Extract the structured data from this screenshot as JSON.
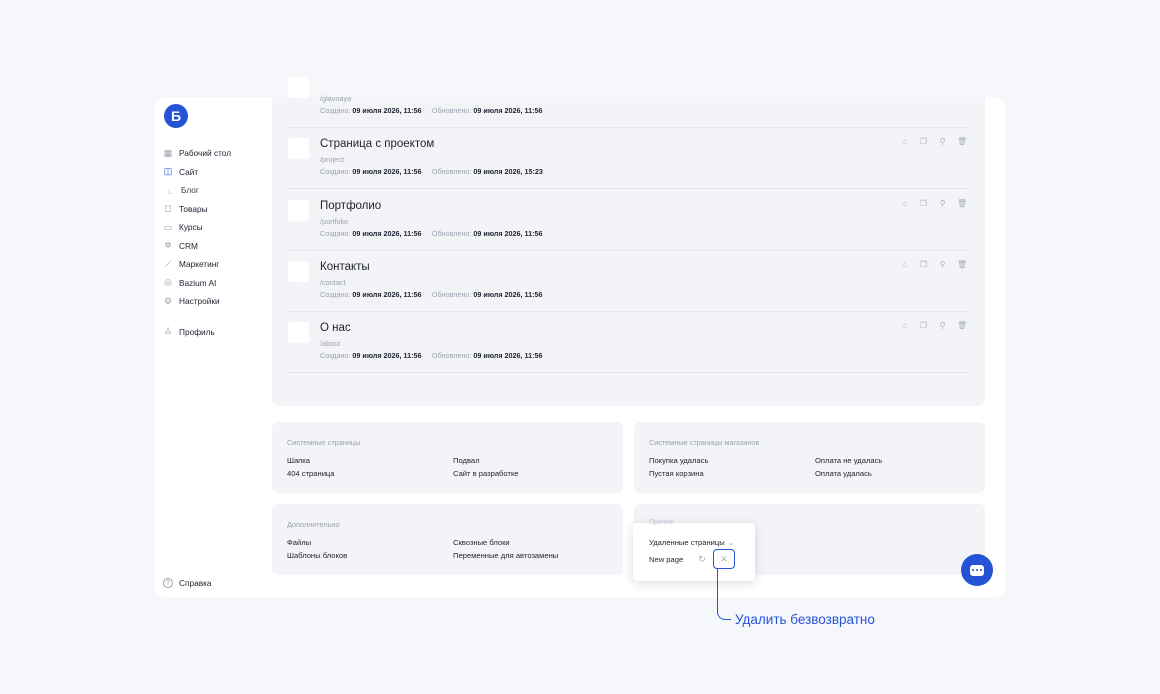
{
  "sidebar": {
    "logo": "Б",
    "items": [
      {
        "label": "Рабочий стол",
        "icon": "grid-icon",
        "glyph": "▦"
      },
      {
        "label": "Сайт",
        "icon": "layout-icon",
        "glyph": "◫"
      },
      {
        "label": "Блог",
        "icon": "subitem-icon",
        "glyph": "⌞"
      },
      {
        "label": "Товары",
        "icon": "bag-icon",
        "glyph": "◻"
      },
      {
        "label": "Курсы",
        "icon": "book-icon",
        "glyph": "▭"
      },
      {
        "label": "CRM",
        "icon": "network-icon",
        "glyph": "✲"
      },
      {
        "label": "Маркетинг",
        "icon": "chart-icon",
        "glyph": "⟋"
      },
      {
        "label": "Bazium AI",
        "icon": "ai-icon",
        "glyph": "◎"
      },
      {
        "label": "Настройки",
        "icon": "gear-icon",
        "glyph": "⚙"
      }
    ],
    "profile": "Профиль",
    "help": "Справка"
  },
  "pages": [
    {
      "title": "",
      "slug": "/glavnaya",
      "created": "09 июля 2026, 11:56",
      "updated": "09 июля 2026, 11:56"
    },
    {
      "title": "Страница с проектом",
      "slug": "/project",
      "created": "09 июля 2026, 11:56",
      "updated": "09 июля 2026, 15:23"
    },
    {
      "title": "Портфолио",
      "slug": "/portfolio",
      "created": "09 июля 2026, 11:56",
      "updated": "09 июля 2026, 11:56"
    },
    {
      "title": "Контакты",
      "slug": "/contact",
      "created": "09 июля 2026, 11:56",
      "updated": "09 июля 2026, 11:56"
    },
    {
      "title": "О нас",
      "slug": "/about",
      "created": "09 июля 2026, 11:56",
      "updated": "09 июля 2026, 11:56"
    }
  ],
  "meta_labels": {
    "created": "Создано:",
    "updated": "Обновлено:",
    "sep": "·"
  },
  "row_actions": [
    "⌂",
    "❐",
    "⚲",
    "🗑"
  ],
  "cards": {
    "system": {
      "title": "Системные страницы",
      "links": [
        "Шапка",
        "Подвал",
        "404 страница",
        "Сайт в разработке"
      ]
    },
    "shop": {
      "title": "Системные страницы магазинов",
      "links": [
        "Покупка удалась",
        "Оплата не удалась",
        "Пустая корзина",
        "Оплата удалась"
      ]
    },
    "extra": {
      "title": "Дополнительно",
      "links": [
        "Файлы",
        "Сквозные блоки",
        "Шаблоны блоков",
        "Переменные для автозамены"
      ]
    }
  },
  "popup": {
    "ghost": "Прочее",
    "heading": "Удаленные страницы",
    "caret": "⌄",
    "item": "New page",
    "restore_glyph": "↻",
    "delete_glyph": "✕"
  },
  "callout": "Удалить безвозвратно"
}
